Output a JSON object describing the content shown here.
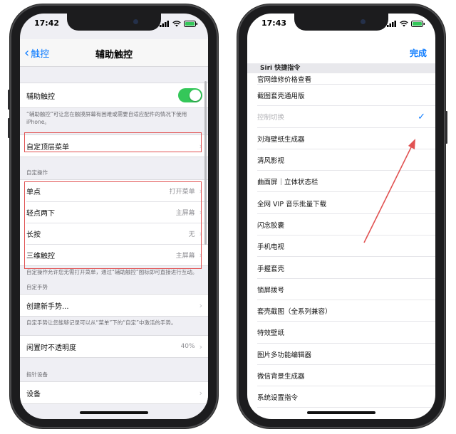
{
  "left_phone": {
    "status": {
      "time": "17:42"
    },
    "nav": {
      "back_label": "触控",
      "title": "辅助触控"
    },
    "assistive_touch": {
      "label": "辅助触控",
      "enabled": true,
      "note": "“辅助触控”可让您在触摸屏幕有困难或需要自适应配件的情况下使用iPhone。"
    },
    "customize_menu": {
      "label": "自定顶层菜单"
    },
    "custom_actions": {
      "header": "自定操作",
      "items": [
        {
          "label": "单点",
          "value": "打开菜单"
        },
        {
          "label": "轻点两下",
          "value": "主屏幕"
        },
        {
          "label": "长按",
          "value": "无"
        },
        {
          "label": "三维触控",
          "value": "主屏幕"
        }
      ],
      "note": "自定操作允许您无需打开菜单，通过“辅助触控”图标即可直接进行互动。"
    },
    "custom_gestures": {
      "header": "自定手势",
      "create_label": "创建新手势...",
      "note": "自定手势让您能够记录可以从“菜单”下的“自定”中激活的手势。"
    },
    "idle_opacity": {
      "label": "闲置时不透明度",
      "value": "40%"
    },
    "pointer_devices": {
      "header": "指针设备",
      "devices_label": "设备"
    }
  },
  "right_phone": {
    "status": {
      "time": "17:43"
    },
    "nav": {
      "done_label": "完成"
    },
    "list_header": "Siri 快捷指令",
    "items": [
      {
        "label": "官网维修价格查看"
      },
      {
        "label": "截图套壳通用版"
      },
      {
        "label": "控制切换",
        "checked": true
      },
      {
        "label": "刘海壁纸生成器"
      },
      {
        "label": "清风影视"
      },
      {
        "label": "曲面屏｜立体状态栏"
      },
      {
        "label": "全网 VIP 音乐批量下载"
      },
      {
        "label": "闪念胶囊"
      },
      {
        "label": "手机电视"
      },
      {
        "label": "手握套壳"
      },
      {
        "label": "锁屏拨号"
      },
      {
        "label": "套壳截图（全系列兼容）"
      },
      {
        "label": "特效壁纸"
      },
      {
        "label": "图片多功能编辑器"
      },
      {
        "label": "微信背景生成器"
      },
      {
        "label": "系统设置指令"
      }
    ]
  },
  "colors": {
    "accent": "#0a7aff",
    "toggle_on": "#34c759",
    "annotation_red": "#e15252",
    "group_bg": "#efeff4"
  }
}
